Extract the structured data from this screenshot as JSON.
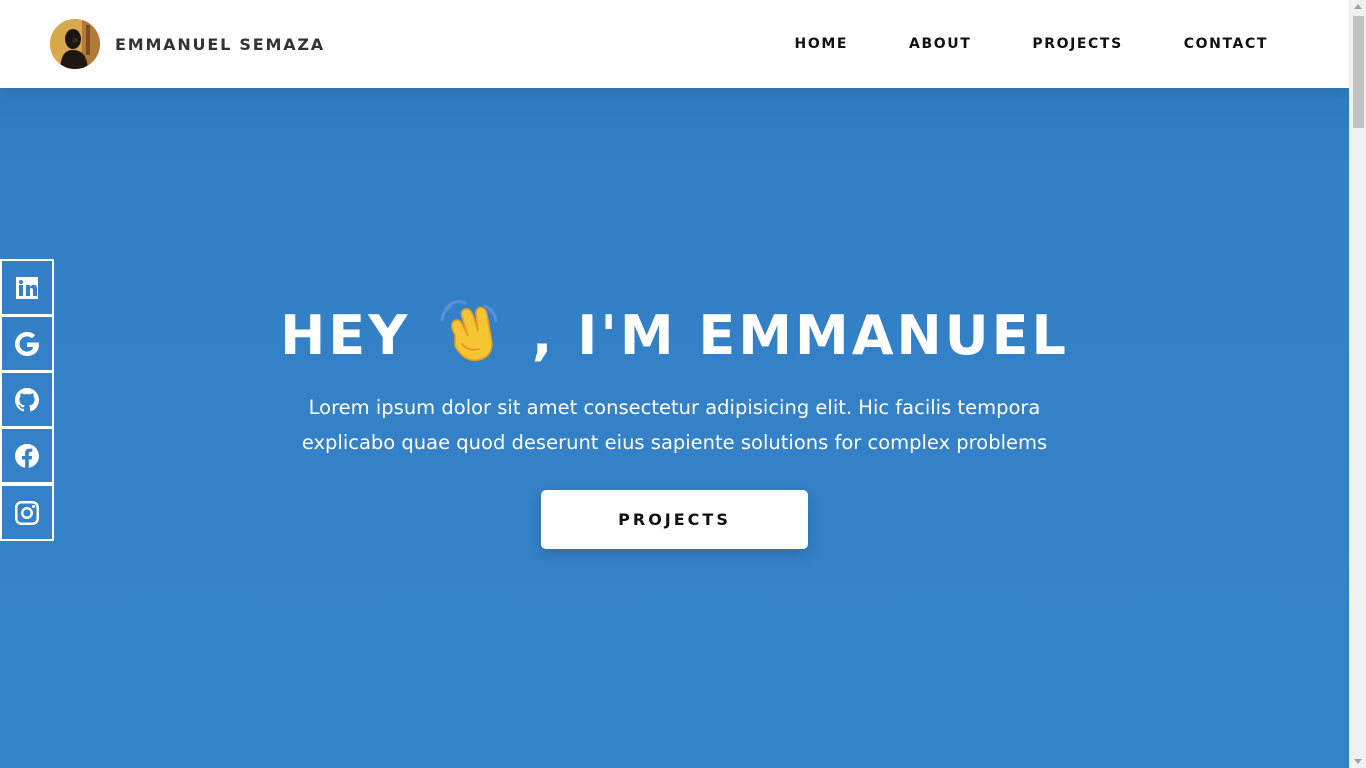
{
  "header": {
    "brand_name": "EMMANUEL SEMAZA",
    "nav": [
      {
        "label": "HOME"
      },
      {
        "label": "ABOUT"
      },
      {
        "label": "PROJECTS"
      },
      {
        "label": "CONTACT"
      }
    ]
  },
  "hero": {
    "title_before": "HEY",
    "title_after": ", I'M EMMANUEL",
    "description": "Lorem ipsum dolor sit amet consectetur adipisicing elit. Hic facilis tempora explicabo quae quod deserunt eius sapiente solutions for complex problems",
    "button_label": "PROJECTS"
  },
  "social": [
    {
      "icon": "linkedin-icon"
    },
    {
      "icon": "google-icon"
    },
    {
      "icon": "github-icon"
    },
    {
      "icon": "facebook-icon"
    },
    {
      "icon": "instagram-icon"
    }
  ],
  "colors": {
    "hero_background": "#3482C8",
    "header_background": "#FFFFFF",
    "text_dark": "#111111",
    "text_light": "#FFFFFF"
  }
}
